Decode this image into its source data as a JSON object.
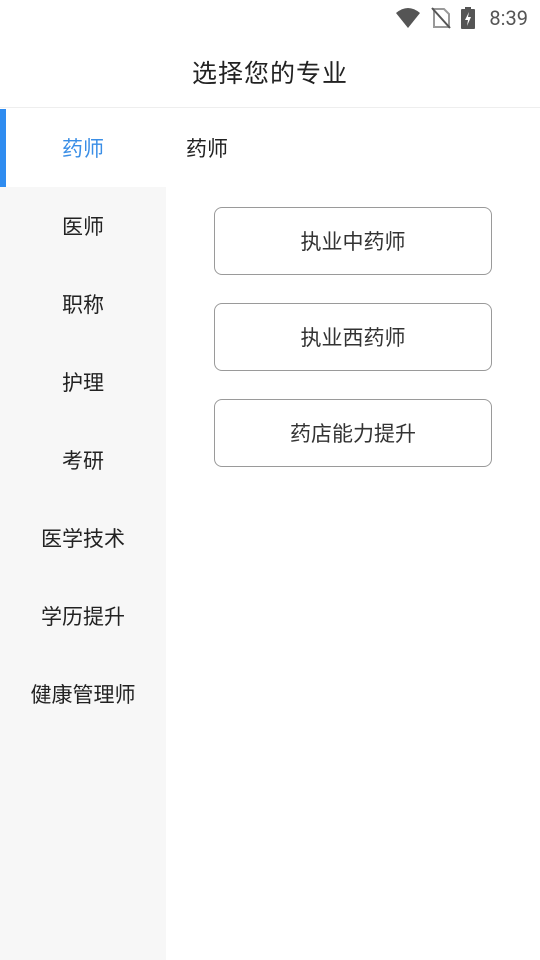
{
  "status_bar": {
    "time": "8:39",
    "icons": [
      "wifi-icon",
      "no-sim-icon",
      "battery-charging-icon"
    ]
  },
  "header": {
    "title": "选择您的专业"
  },
  "sidebar": {
    "items": [
      {
        "label": "药师",
        "active": true
      },
      {
        "label": "医师",
        "active": false
      },
      {
        "label": "职称",
        "active": false
      },
      {
        "label": "护理",
        "active": false
      },
      {
        "label": "考研",
        "active": false
      },
      {
        "label": "医学技术",
        "active": false
      },
      {
        "label": "学历提升",
        "active": false
      },
      {
        "label": "健康管理师",
        "active": false
      }
    ],
    "active_color": "#3a8ee6"
  },
  "content": {
    "section_title": "药师",
    "options": [
      {
        "label": "执业中药师"
      },
      {
        "label": "执业西药师"
      },
      {
        "label": "药店能力提升"
      }
    ]
  }
}
